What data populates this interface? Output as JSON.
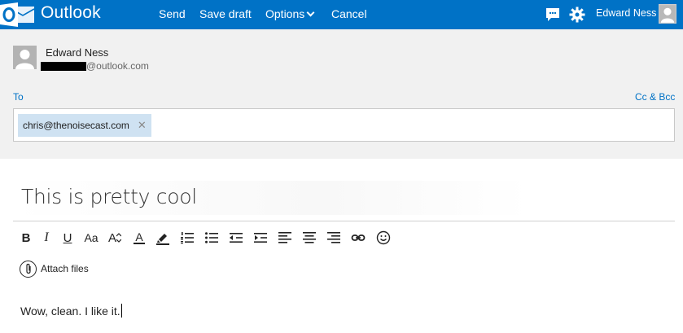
{
  "app": {
    "name": "Outlook"
  },
  "topbar": {
    "send": "Send",
    "save_draft": "Save draft",
    "options": "Options",
    "cancel": "Cancel",
    "user_name": "Edward Ness"
  },
  "sender": {
    "name": "Edward Ness",
    "email_domain": "@outlook.com"
  },
  "recipients": {
    "to_label": "To",
    "cc_bcc_label": "Cc & Bcc",
    "to": [
      "chris@thenoisecast.com"
    ],
    "remove_glyph": "✕"
  },
  "subject": "This is pretty cool",
  "format_toolbar": {
    "tools": [
      "bold-icon",
      "italic-icon",
      "underline-icon",
      "font-size-icon",
      "grow-font-icon",
      "font-color-icon",
      "highlight-icon",
      "numbered-list-icon",
      "bulleted-list-icon",
      "decrease-indent-icon",
      "increase-indent-icon",
      "align-left-icon",
      "align-center-icon",
      "align-right-icon",
      "link-icon",
      "emoji-icon"
    ],
    "bold": "B",
    "italic": "I",
    "underline": "U",
    "font_size": "Aa",
    "grow_font": "A",
    "font_color": "A"
  },
  "attach": {
    "label": "Attach files"
  },
  "body": "Wow, clean. I like it.",
  "colors": {
    "brand": "#0072c6",
    "chip": "#cfe2f2",
    "header_bg": "#f1f1f1"
  }
}
